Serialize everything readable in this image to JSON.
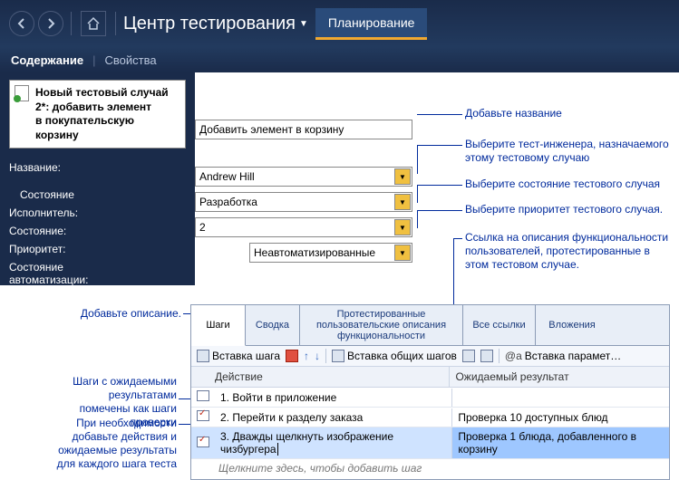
{
  "header": {
    "title": "Центр тестирования",
    "tab": "Планирование"
  },
  "subheader": {
    "tab1": "Содержание",
    "tab2": "Свойства"
  },
  "testcase": {
    "title_line1": "Новый тестовый случай 2*: добавить элемент",
    "title_line2": "в покупательскую корзину",
    "name_label": "Название:",
    "name_value": "Добавить элемент в корзину",
    "state_group": "Состояние",
    "assignee_label": "Исполнитель:",
    "assignee_value": "Andrew Hill",
    "state_label": "Состояние:",
    "state_value": "Разработка",
    "priority_label": "Приоритет:",
    "priority_value": "2",
    "autostate_label": "Состояние автоматизации:",
    "autostate_value": "Неавтоматизированные"
  },
  "callouts": {
    "add_title": "Добавьте название",
    "select_engineer": "Выберите тест-инженера, назначаемого этому тестовому случаю",
    "select_state": "Выберите состояние тестового случая",
    "select_priority": "Выберите приоритет тестового случая.",
    "func_link": "Ссылка на описания функциональности пользователей, протестированные в этом тестовом случае.",
    "add_desc": "Добавьте описание.",
    "steps_marked": "Шаги с ожидаемыми результатами помечены как шаги проверки",
    "add_actions": "При необходимости добавьте действия и ожидаемые результаты для каждого шага теста"
  },
  "tabs": {
    "steps": "Шаги",
    "summary": "Сводка",
    "tested": "Протестированные пользовательские описания функциональности",
    "alllinks": "Все ссылки",
    "attach": "Вложения"
  },
  "toolbar": {
    "insert_step": "Вставка шага",
    "insert_shared": "Вставка общих шагов",
    "insert_param": "Вставка парамет…"
  },
  "grid": {
    "col_action": "Действие",
    "col_expected": "Ожидаемый результат",
    "rows": [
      {
        "n": "1.",
        "action": "Войти в приложение",
        "expected": ""
      },
      {
        "n": "2.",
        "action": "Перейти к разделу заказа",
        "expected": "Проверка 10 доступных блюд"
      },
      {
        "n": "3.",
        "action": "Дважды щелкнуть изображение чизбургера",
        "expected": "Проверка 1 блюда, добавленного в корзину"
      }
    ],
    "add_hint": "Щелкните здесь, чтобы добавить шаг"
  }
}
